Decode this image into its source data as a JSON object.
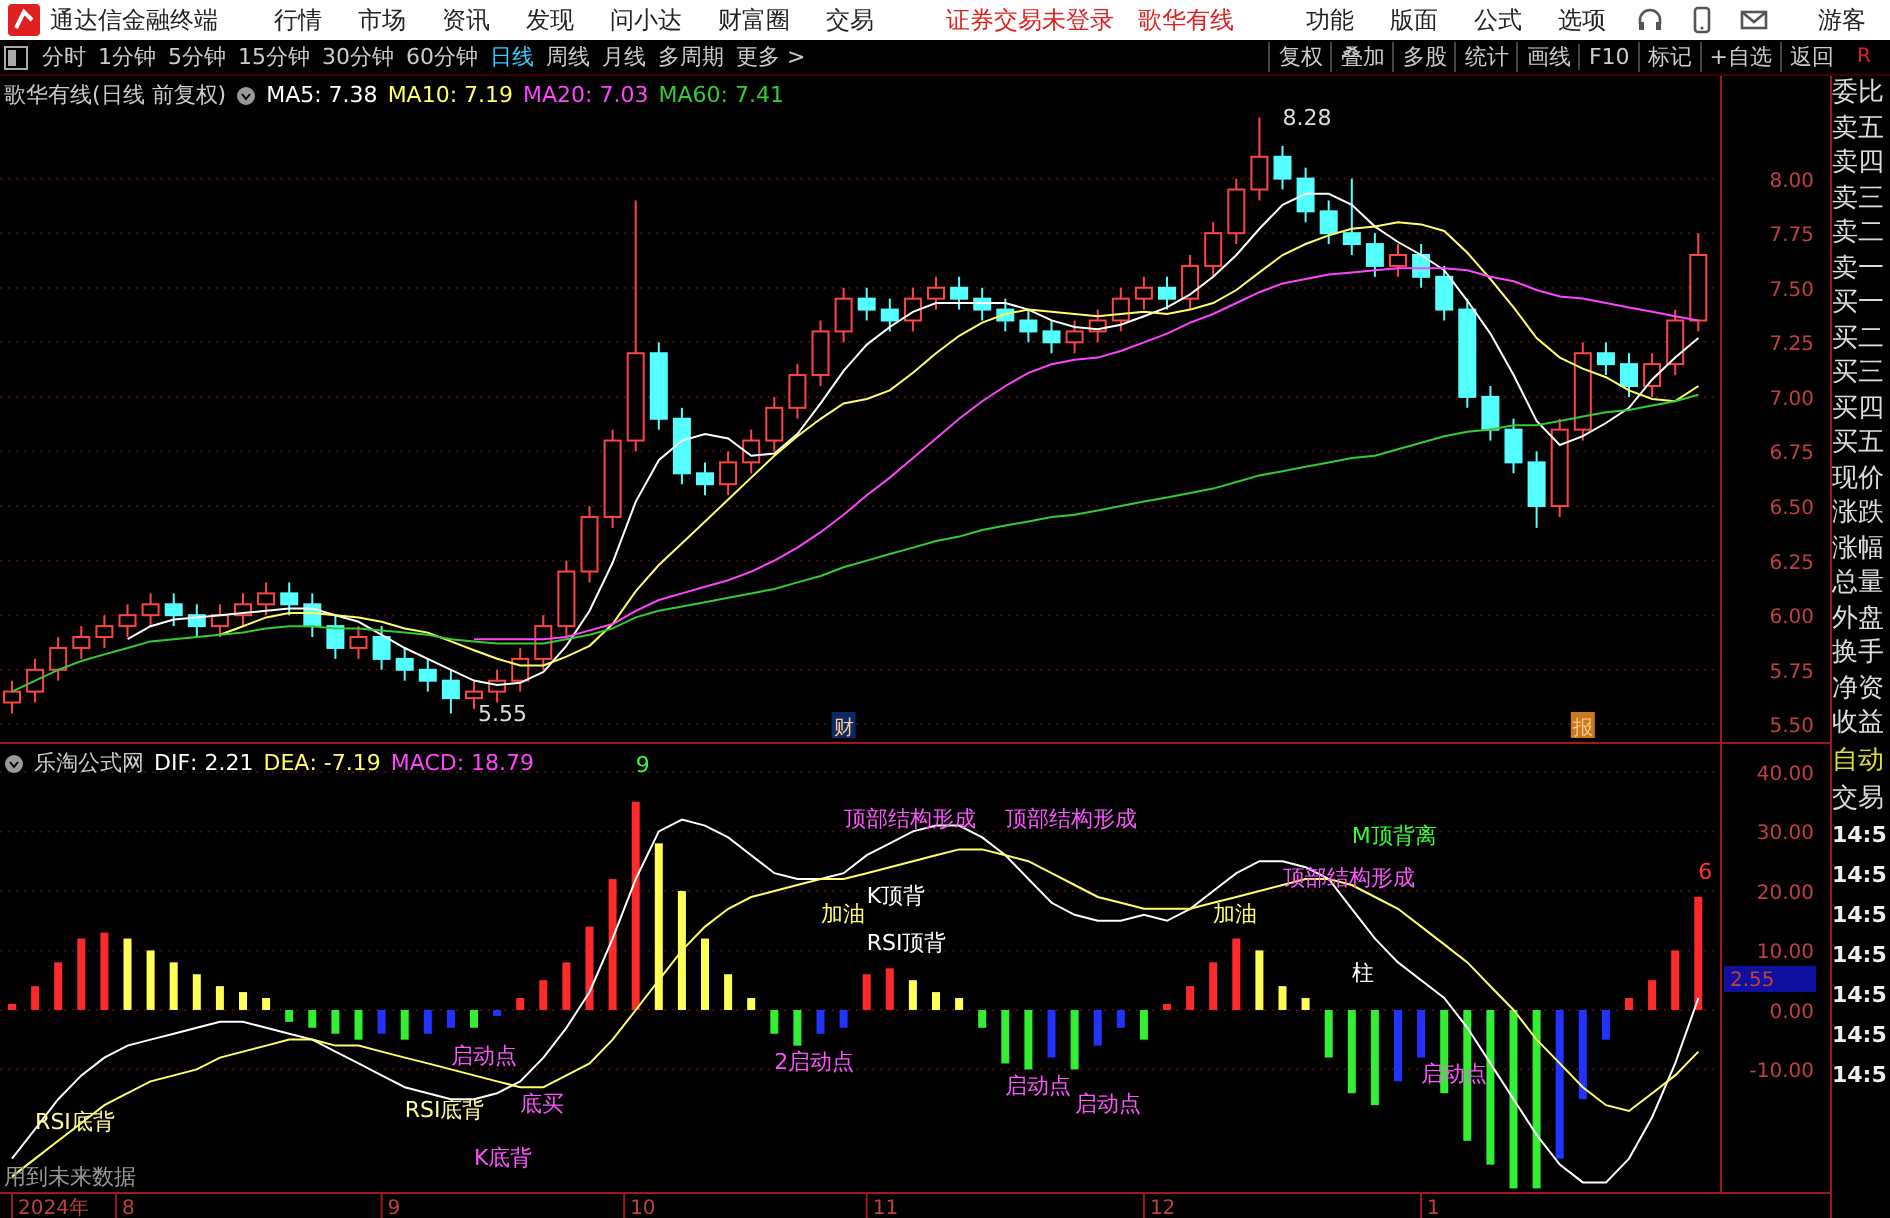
{
  "app_bar": {
    "title": "通达信金融终端",
    "menu": [
      "行情",
      "市场",
      "资讯",
      "发现",
      "问小达",
      "财富圈",
      "交易"
    ],
    "status": [
      "证券交易未登录",
      "歌华有线"
    ],
    "right_menu": [
      "功能",
      "版面",
      "公式",
      "选项"
    ],
    "user": "游客"
  },
  "toolbar": {
    "periods": [
      {
        "label": "分时",
        "selected": false
      },
      {
        "label": "1分钟",
        "selected": false
      },
      {
        "label": "5分钟",
        "selected": false
      },
      {
        "label": "15分钟",
        "selected": false
      },
      {
        "label": "30分钟",
        "selected": false
      },
      {
        "label": "60分钟",
        "selected": false
      },
      {
        "label": "日线",
        "selected": true
      },
      {
        "label": "周线",
        "selected": false
      },
      {
        "label": "月线",
        "selected": false
      },
      {
        "label": "多周期",
        "selected": false
      },
      {
        "label": "更多 >",
        "selected": false
      }
    ],
    "tools": [
      "复权",
      "叠加",
      "多股",
      "统计",
      "画线",
      "F10",
      "标记",
      "+自选",
      "返回"
    ],
    "corner": "R"
  },
  "price_pane": {
    "title": "歌华有线(日线 前复权)",
    "readings": [
      ": 7.38",
      ": 7.19",
      ": 7.03",
      ": 7.41"
    ],
    "chart_data": {
      "type": "candlestick",
      "grid": true,
      "ylim": [
        5.41,
        8.47
      ],
      "yticks": [
        {
          "value": 8,
          "label": "8.00"
        },
        {
          "value": 7.75,
          "label": "7.75"
        },
        {
          "value": 7.5,
          "label": "7.50"
        },
        {
          "value": 7.25,
          "label": "7.25"
        },
        {
          "value": 7,
          "label": "7.00"
        },
        {
          "value": 6.75,
          "label": "6.75"
        },
        {
          "value": 6.5,
          "label": "6.50"
        },
        {
          "value": 6.25,
          "label": "6.25"
        },
        {
          "value": 6,
          "label": "6.00"
        },
        {
          "value": 5.75,
          "label": "5.75"
        },
        {
          "value": 5.5,
          "label": "5.50"
        }
      ],
      "ohlc": [
        [
          5.6,
          5.7,
          5.55,
          5.65
        ],
        [
          5.65,
          5.8,
          5.6,
          5.75
        ],
        [
          5.75,
          5.9,
          5.7,
          5.85
        ],
        [
          5.85,
          5.95,
          5.8,
          5.9
        ],
        [
          5.9,
          6.0,
          5.85,
          5.95
        ],
        [
          5.95,
          6.05,
          5.9,
          6.0
        ],
        [
          6.0,
          6.1,
          5.95,
          6.05
        ],
        [
          6.05,
          6.1,
          5.95,
          6.0
        ],
        [
          6.0,
          6.05,
          5.9,
          5.95
        ],
        [
          5.95,
          6.05,
          5.9,
          6.0
        ],
        [
          6.0,
          6.1,
          5.95,
          6.05
        ],
        [
          6.05,
          6.15,
          6.0,
          6.1
        ],
        [
          6.1,
          6.15,
          6.0,
          6.05
        ],
        [
          6.05,
          6.1,
          5.9,
          5.95
        ],
        [
          5.95,
          6.0,
          5.8,
          5.85
        ],
        [
          5.85,
          5.95,
          5.8,
          5.9
        ],
        [
          5.9,
          5.95,
          5.75,
          5.8
        ],
        [
          5.8,
          5.85,
          5.7,
          5.75
        ],
        [
          5.75,
          5.8,
          5.65,
          5.7
        ],
        [
          5.7,
          5.75,
          5.55,
          5.62
        ],
        [
          5.62,
          5.7,
          5.57,
          5.65
        ],
        [
          5.65,
          5.75,
          5.6,
          5.7
        ],
        [
          5.7,
          5.85,
          5.65,
          5.8
        ],
        [
          5.8,
          6.0,
          5.75,
          5.95
        ],
        [
          5.95,
          6.25,
          5.9,
          6.2
        ],
        [
          6.2,
          6.5,
          6.15,
          6.45
        ],
        [
          6.45,
          6.85,
          6.4,
          6.8
        ],
        [
          6.8,
          7.9,
          6.75,
          7.2
        ],
        [
          7.2,
          7.25,
          6.85,
          6.9
        ],
        [
          6.9,
          6.95,
          6.6,
          6.65
        ],
        [
          6.65,
          6.7,
          6.55,
          6.6
        ],
        [
          6.6,
          6.75,
          6.55,
          6.7
        ],
        [
          6.7,
          6.85,
          6.65,
          6.8
        ],
        [
          6.8,
          7.0,
          6.75,
          6.95
        ],
        [
          6.95,
          7.15,
          6.9,
          7.1
        ],
        [
          7.1,
          7.35,
          7.05,
          7.3
        ],
        [
          7.3,
          7.5,
          7.25,
          7.45
        ],
        [
          7.45,
          7.5,
          7.35,
          7.4
        ],
        [
          7.4,
          7.45,
          7.3,
          7.35
        ],
        [
          7.35,
          7.5,
          7.3,
          7.45
        ],
        [
          7.45,
          7.55,
          7.4,
          7.5
        ],
        [
          7.5,
          7.55,
          7.4,
          7.45
        ],
        [
          7.45,
          7.5,
          7.35,
          7.4
        ],
        [
          7.4,
          7.45,
          7.3,
          7.35
        ],
        [
          7.35,
          7.4,
          7.25,
          7.3
        ],
        [
          7.3,
          7.35,
          7.2,
          7.25
        ],
        [
          7.25,
          7.35,
          7.2,
          7.3
        ],
        [
          7.3,
          7.4,
          7.25,
          7.35
        ],
        [
          7.35,
          7.5,
          7.3,
          7.45
        ],
        [
          7.45,
          7.55,
          7.4,
          7.5
        ],
        [
          7.5,
          7.55,
          7.4,
          7.45
        ],
        [
          7.45,
          7.65,
          7.4,
          7.6
        ],
        [
          7.6,
          7.8,
          7.55,
          7.75
        ],
        [
          7.75,
          8.0,
          7.7,
          7.95
        ],
        [
          7.95,
          8.28,
          7.9,
          8.1
        ],
        [
          8.1,
          8.15,
          7.95,
          8.0
        ],
        [
          8.0,
          8.05,
          7.8,
          7.85
        ],
        [
          7.85,
          7.9,
          7.7,
          7.75
        ],
        [
          7.75,
          8.0,
          7.65,
          7.7
        ],
        [
          7.7,
          7.75,
          7.55,
          7.6
        ],
        [
          7.6,
          7.7,
          7.55,
          7.65
        ],
        [
          7.65,
          7.7,
          7.5,
          7.55
        ],
        [
          7.55,
          7.6,
          7.35,
          7.4
        ],
        [
          7.4,
          7.45,
          6.95,
          7.0
        ],
        [
          7.0,
          7.05,
          6.8,
          6.85
        ],
        [
          6.85,
          6.9,
          6.65,
          6.7
        ],
        [
          6.7,
          6.75,
          6.4,
          6.5
        ],
        [
          6.5,
          6.9,
          6.45,
          6.85
        ],
        [
          6.85,
          7.25,
          6.8,
          7.2
        ],
        [
          7.2,
          7.25,
          7.1,
          7.15
        ],
        [
          7.15,
          7.2,
          7.0,
          7.05
        ],
        [
          7.05,
          7.2,
          7.0,
          7.15
        ],
        [
          7.15,
          7.4,
          7.1,
          7.35
        ],
        [
          7.35,
          7.75,
          7.3,
          7.65
        ]
      ],
      "series": [
        {
          "name": "MA5",
          "type": "line",
          "color": "#ffffff",
          "values": [
            null,
            null,
            null,
            null,
            null,
            5.89,
            5.95,
            5.98,
            5.99,
            6.0,
            6.01,
            6.02,
            6.03,
            6.03,
            6.0,
            5.97,
            5.91,
            5.85,
            5.8,
            5.75,
            5.7,
            5.68,
            5.69,
            5.74,
            5.86,
            6.02,
            6.24,
            6.52,
            6.71,
            6.8,
            6.83,
            6.81,
            6.73,
            6.74,
            6.83,
            6.97,
            7.12,
            7.24,
            7.32,
            7.39,
            7.43,
            7.43,
            7.43,
            7.43,
            7.4,
            7.35,
            7.32,
            7.31,
            7.33,
            7.37,
            7.41,
            7.47,
            7.55,
            7.65,
            7.77,
            7.88,
            7.93,
            7.93,
            7.88,
            7.78,
            7.71,
            7.65,
            7.58,
            7.44,
            7.29,
            7.1,
            6.89,
            6.78,
            6.82,
            6.88,
            6.95,
            7.08,
            7.18,
            7.27
          ]
        },
        {
          "name": "MA10",
          "type": "line",
          "color": "#ffff66",
          "values": [
            null,
            null,
            null,
            null,
            null,
            null,
            null,
            null,
            null,
            5.91,
            5.95,
            5.99,
            6.01,
            6.01,
            6.0,
            5.99,
            5.97,
            5.94,
            5.92,
            5.88,
            5.84,
            5.8,
            5.77,
            5.77,
            5.81,
            5.86,
            5.96,
            6.11,
            6.23,
            6.33,
            6.43,
            6.53,
            6.63,
            6.73,
            6.82,
            6.9,
            6.97,
            6.99,
            7.03,
            7.11,
            7.2,
            7.28,
            7.34,
            7.38,
            7.4,
            7.39,
            7.38,
            7.37,
            7.38,
            7.39,
            7.38,
            7.4,
            7.43,
            7.49,
            7.57,
            7.65,
            7.7,
            7.74,
            7.77,
            7.78,
            7.8,
            7.79,
            7.76,
            7.66,
            7.54,
            7.41,
            7.27,
            7.18,
            7.13,
            7.09,
            7.03,
            6.99,
            6.98,
            7.05
          ]
        },
        {
          "name": "MA20",
          "type": "line",
          "color": "#ff44ff",
          "values": [
            null,
            null,
            null,
            null,
            null,
            null,
            null,
            null,
            null,
            null,
            null,
            null,
            null,
            null,
            null,
            null,
            null,
            null,
            null,
            null,
            5.89,
            5.89,
            5.89,
            5.89,
            5.9,
            5.93,
            5.96,
            6.02,
            6.07,
            6.1,
            6.13,
            6.16,
            6.2,
            6.25,
            6.31,
            6.38,
            6.46,
            6.55,
            6.63,
            6.72,
            6.81,
            6.9,
            6.98,
            7.05,
            7.11,
            7.15,
            7.17,
            7.18,
            7.21,
            7.25,
            7.29,
            7.34,
            7.38,
            7.43,
            7.48,
            7.52,
            7.54,
            7.56,
            7.57,
            7.58,
            7.59,
            7.59,
            7.59,
            7.58,
            7.55,
            7.53,
            7.49,
            7.46,
            7.45,
            7.43,
            7.41,
            7.39,
            7.37,
            7.35
          ]
        },
        {
          "name": "MA60",
          "type": "line",
          "color": "#33cc33",
          "values": [
            5.65,
            5.7,
            5.75,
            5.79,
            5.82,
            5.85,
            5.88,
            5.89,
            5.9,
            5.91,
            5.92,
            5.94,
            5.95,
            5.95,
            5.94,
            5.94,
            5.93,
            5.92,
            5.91,
            5.89,
            5.88,
            5.87,
            5.87,
            5.87,
            5.89,
            5.91,
            5.94,
            5.99,
            6.02,
            6.04,
            6.06,
            6.08,
            6.1,
            6.12,
            6.15,
            6.18,
            6.22,
            6.25,
            6.28,
            6.31,
            6.34,
            6.36,
            6.39,
            6.41,
            6.43,
            6.45,
            6.46,
            6.48,
            6.5,
            6.52,
            6.54,
            6.56,
            6.58,
            6.61,
            6.64,
            6.66,
            6.68,
            6.7,
            6.72,
            6.73,
            6.76,
            6.79,
            6.82,
            6.84,
            6.85,
            6.87,
            6.87,
            6.89,
            6.91,
            6.93,
            6.94,
            6.96,
            6.98,
            7.01
          ]
        }
      ]
    },
    "high_label": "8.28",
    "low_label": "5.55",
    "markers": [
      {
        "kind": "event",
        "text": "财"
      },
      {
        "kind": "report",
        "text": "报"
      }
    ]
  },
  "indicator_pane": {
    "title": "乐淘公式网",
    "readings": [
      ": 2.21",
      ": -7.19",
      ": 18.79"
    ],
    "chart_data": {
      "type": "bar",
      "grid": true,
      "ylim": [
        -30.6,
        44.7
      ],
      "yticks": [
        {
          "value": 40,
          "label": "40.00"
        },
        {
          "value": 30,
          "label": "30.00"
        },
        {
          "value": 20,
          "label": "20.00"
        },
        {
          "value": 10,
          "label": "10.00"
        },
        {
          "value": 0,
          "label": "0.00"
        },
        {
          "value": -10,
          "label": "-10.00"
        }
      ],
      "series": [
        {
          "name": "DIF",
          "type": "line",
          "color": "#ffffff",
          "values": [
            -25,
            -20,
            -15,
            -11,
            -8,
            -6,
            -5,
            -4,
            -3,
            -2,
            -2,
            -3,
            -4,
            -5,
            -7,
            -9,
            -11,
            -13,
            -14,
            -15,
            -15,
            -14,
            -12,
            -8,
            -3,
            3,
            12,
            22,
            30,
            32,
            31,
            29,
            26,
            23,
            22,
            22,
            23,
            26,
            28,
            30,
            31,
            31,
            29,
            26,
            22,
            18,
            16,
            15,
            15,
            16,
            15,
            17,
            20,
            23,
            25,
            25,
            24,
            22,
            17,
            12,
            8,
            5,
            2,
            -3,
            -9,
            -15,
            -21,
            -26,
            -29,
            -29,
            -25,
            -18,
            -9,
            2
          ]
        },
        {
          "name": "DEA",
          "type": "line",
          "color": "#ffff66",
          "values": [
            -28,
            -25,
            -22,
            -19,
            -16,
            -14,
            -12,
            -11,
            -10,
            -8,
            -7,
            -6,
            -5,
            -5,
            -6,
            -6,
            -7,
            -8,
            -9,
            -10,
            -11,
            -12,
            -13,
            -13,
            -11,
            -9,
            -5,
            0,
            5,
            10,
            14,
            17,
            19,
            20,
            21,
            22,
            22,
            23,
            24,
            25,
            26,
            27,
            27,
            26,
            25,
            23,
            21,
            19,
            18,
            17,
            17,
            17,
            18,
            19,
            20,
            21,
            22,
            22,
            21,
            19,
            17,
            14,
            11,
            8,
            4,
            0,
            -5,
            -9,
            -13,
            -16,
            -17,
            -14,
            -11,
            -7
          ]
        },
        {
          "name": "MACD",
          "colors": [
            "#ff2a2a",
            "#ff2a2a",
            "#ff2a2a",
            "#ff2a2a",
            "#ff2a2a",
            "#ffff55",
            "#ffff55",
            "#ffff55",
            "#ffff55",
            "#ffff55",
            "#ffff55",
            "#ffff55",
            "#33ee33",
            "#33ee33",
            "#33ee33",
            "#33ee33",
            "#2233ff",
            "#33ee33",
            "#2233ff",
            "#2233ff",
            "#33ee33",
            "#2233ff",
            "#ff2a2a",
            "#ff2a2a",
            "#ff2a2a",
            "#ff2a2a",
            "#ff2a2a",
            "#ff2a2a",
            "#ffff55",
            "#ffff55",
            "#ffff55",
            "#ffff55",
            "#ffff55",
            "#33ee33",
            "#33ee33",
            "#2233ff",
            "#2233ff",
            "#ff2a2a",
            "#ff2a2a",
            "#ffff55",
            "#ffff55",
            "#ffff55",
            "#33ee33",
            "#33ee33",
            "#33ee33",
            "#2233ff",
            "#33ee33",
            "#2233ff",
            "#2233ff",
            "#33ee33",
            "#ff2a2a",
            "#ff2a2a",
            "#ff2a2a",
            "#ff2a2a",
            "#ffff55",
            "#ffff55",
            "#ffff55",
            "#33ee33",
            "#33ee33",
            "#33ee33",
            "#2233ff",
            "#2233ff",
            "#33ee33",
            "#33ee33",
            "#33ee33",
            "#33ee33",
            "#33ee33",
            "#2233ff",
            "#2233ff",
            "#2233ff",
            "#ff2a2a",
            "#ff2a2a",
            "#ff2a2a",
            "#ff2a2a"
          ],
          "values": [
            1,
            4,
            8,
            12,
            13,
            12,
            10,
            8,
            6,
            4,
            3,
            2,
            -2,
            -3,
            -4,
            -5,
            -4,
            -5,
            -4,
            -3,
            -3,
            -1,
            2,
            5,
            8,
            14,
            22,
            35,
            28,
            20,
            12,
            6,
            2,
            -4,
            -6,
            -4,
            -3,
            6,
            7,
            5,
            3,
            2,
            -3,
            -9,
            -10,
            -8,
            -10,
            -6,
            -3,
            -5,
            1,
            4,
            8,
            12,
            10,
            4,
            2,
            -8,
            -14,
            -16,
            -12,
            -8,
            -14,
            -22,
            -26,
            -30,
            -30,
            -25,
            -15,
            -5,
            2,
            5,
            10,
            19
          ]
        }
      ],
      "annotations": [
        "RSI底背",
        "RSI底背",
        "启动点",
        "底买",
        "K底背",
        "9",
        "2启动点",
        "加油",
        "顶部结构形成",
        "顶部结构形成",
        "K顶背",
        "RSI顶背",
        "启动点",
        "启动点",
        "加油",
        "M顶背离",
        "顶部结构形成",
        "柱",
        "启动点",
        "6"
      ]
    },
    "x_axis": [
      "2024年",
      "8",
      "9",
      "10",
      "11",
      "12",
      "1"
    ],
    "current_value": "2.55",
    "note": "用到未来数据"
  },
  "right_panel": {
    "quote_labels": [
      "委比",
      "卖五",
      "卖四",
      "卖三",
      "卖二",
      "卖一",
      "买一",
      "买二",
      "买三",
      "买四",
      "买五",
      "现价",
      "涨跌",
      "涨幅",
      "总量",
      "外盘",
      "换手",
      "净资",
      "收益"
    ],
    "auto_label": "自动",
    "trade_label": "交易",
    "times": [
      "14:5",
      "14:5",
      "14:5",
      "14:5",
      "14:5",
      "14:5",
      "14:5"
    ]
  }
}
